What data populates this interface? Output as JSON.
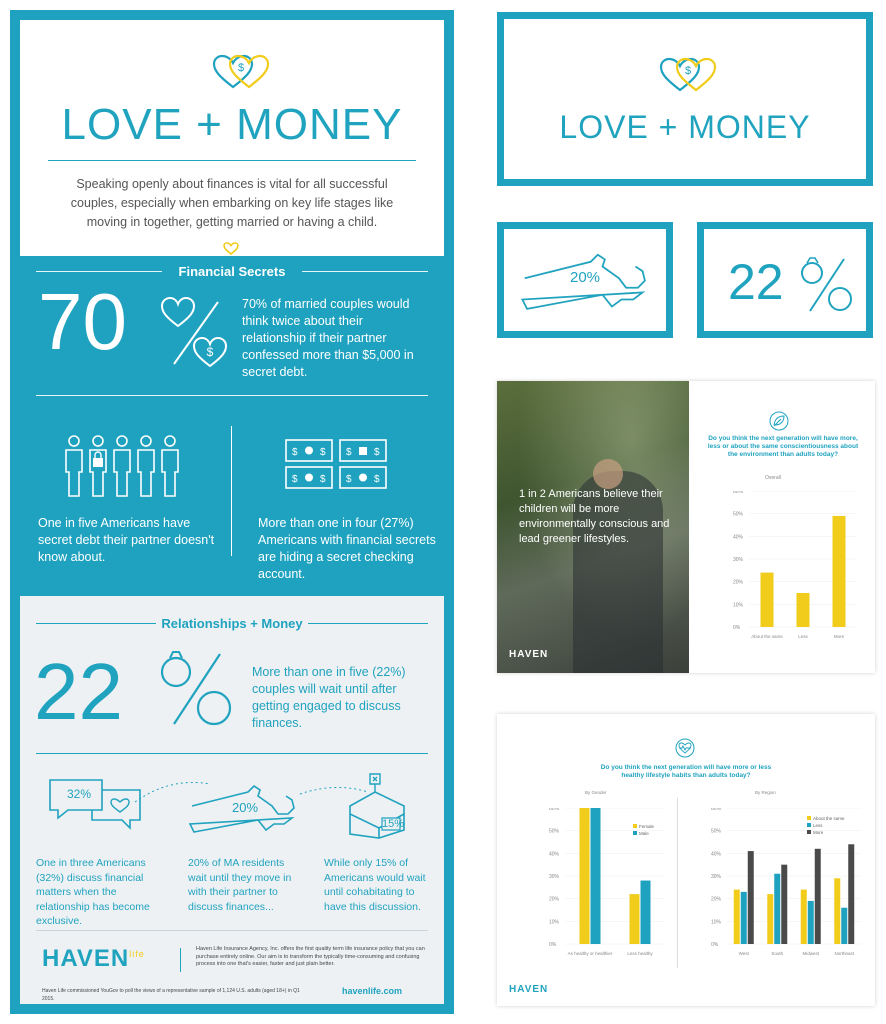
{
  "infographic": {
    "title": "LOVE + MONEY",
    "intro": "Speaking openly about finances is vital for all successful couples, especially when embarking on key life stages like moving in together, getting married or having a child.",
    "section1_title": "Financial Secrets",
    "stat1_number": "70",
    "stat1_text": "70% of married couples would think twice about their relationship if their partner confessed more than $5,000 in secret debt.",
    "stat2_text": "One in five Americans have secret debt their partner doesn't know about.",
    "stat3_text": "More than one in four (27%) Americans with financial secrets are hiding a secret checking account.",
    "section2_title": "Relationships + Money",
    "stat4_number": "22",
    "stat4_text": "More than one in five (22%) couples will wait until after getting engaged to discuss finances.",
    "bubble_value": "32%",
    "state_value": "20%",
    "house_value": "15%",
    "stat5_text": "One in three Americans (32%) discuss financial matters when the relationship has become exclusive.",
    "stat6_text": "20% of MA residents wait until they move in with their partner to discuss finances...",
    "stat7_text": "While only 15% of Americans would wait until cohabitating to have this discussion.",
    "logo_main": "HAVEN",
    "logo_sup": "life",
    "disclaimer": "Haven Life Insurance Agency, Inc. offers the first quality term life insurance policy that you can purchase entirely online. Our aim is to transform the typically time-consuming and confusing process into one that's easier, faster and just plain better.",
    "footnote": "Haven Life commissioned YouGov to poll the views of a representative sample of 1,124 U.S. adults (aged 18+) in Q1 2015.",
    "website": "havenlife.com"
  },
  "thumb_title": "LOVE + MONEY",
  "thumb_state_value": "20%",
  "thumb_22": "22",
  "photo_card": {
    "caption": "1 in 2 Americans believe their children will be more environmentally conscious and lead greener lifestyles.",
    "logo": "HAVEN",
    "question": "Do you think the next generation will have more, less or about the same conscientiousness about the environment than adults today?",
    "overall_label": "Overall"
  },
  "health_card": {
    "question": "Do you think the next generation will have more or less healthy lifestyle habits than adults today?",
    "gender_label": "By Gender",
    "region_label": "By Region",
    "logo": "HAVEN"
  },
  "colors": {
    "teal": "#1ea2bf",
    "yellow": "#f2cc1a",
    "dark": "#4a4a4a"
  },
  "chart_data": [
    {
      "type": "bar",
      "title": "Do you think the next generation will have more, less or about the same conscientiousness about the environment than adults today?",
      "subtitle": "Overall",
      "categories": [
        "About the same",
        "Less",
        "More"
      ],
      "values": [
        24,
        15,
        49
      ],
      "ylim": [
        0,
        60
      ],
      "yticks": [
        "0%",
        "10%",
        "20%",
        "30%",
        "40%",
        "50%",
        "60%"
      ]
    },
    {
      "type": "bar",
      "title": "Do you think the next generation will have more or less healthy lifestyle habits than adults today?",
      "subtitle": "By Gender",
      "categories": [
        "As healthy or healthier",
        "Less healthy"
      ],
      "series": [
        {
          "name": "Female",
          "values": [
            64,
            22
          ]
        },
        {
          "name": "Male",
          "values": [
            63,
            28
          ]
        }
      ],
      "ylim": [
        0,
        60
      ],
      "yticks": [
        "0%",
        "10%",
        "20%",
        "30%",
        "40%",
        "50%",
        "60%"
      ]
    },
    {
      "type": "bar",
      "subtitle": "By Region",
      "categories": [
        "West",
        "South",
        "Midwest",
        "Northeast"
      ],
      "series": [
        {
          "name": "About the same",
          "values": [
            24,
            22,
            24,
            29
          ]
        },
        {
          "name": "Less",
          "values": [
            23,
            31,
            19,
            16
          ]
        },
        {
          "name": "More",
          "values": [
            41,
            35,
            42,
            44
          ]
        }
      ],
      "ylim": [
        0,
        60
      ],
      "yticks": [
        "0%",
        "10%",
        "20%",
        "30%",
        "40%",
        "50%",
        "60%"
      ]
    }
  ]
}
